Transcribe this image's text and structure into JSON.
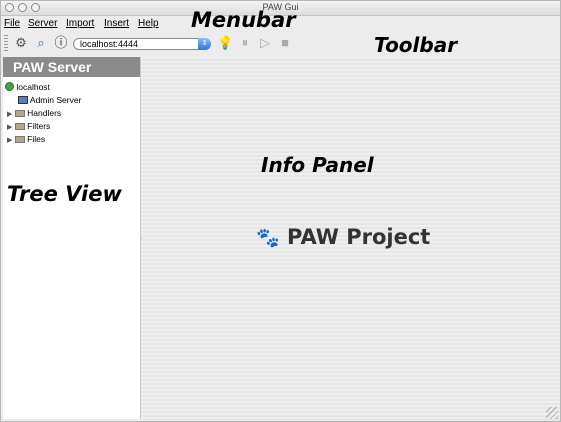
{
  "window": {
    "title": "PAW Gui"
  },
  "menubar": {
    "items": [
      "File",
      "Server",
      "Import",
      "Insert",
      "Help"
    ]
  },
  "toolbar": {
    "server_select": "localhost:4444"
  },
  "tree": {
    "header": "PAW Server",
    "root": "localhost",
    "items": [
      "Admin Server",
      "Handlers",
      "Filters",
      "Files"
    ]
  },
  "info_panel": {
    "project_label": "PAW Project"
  },
  "annotations": {
    "menubar": "Menubar",
    "toolbar": "Toolbar",
    "info_panel": "Info Panel",
    "tree_view": "Tree View"
  }
}
